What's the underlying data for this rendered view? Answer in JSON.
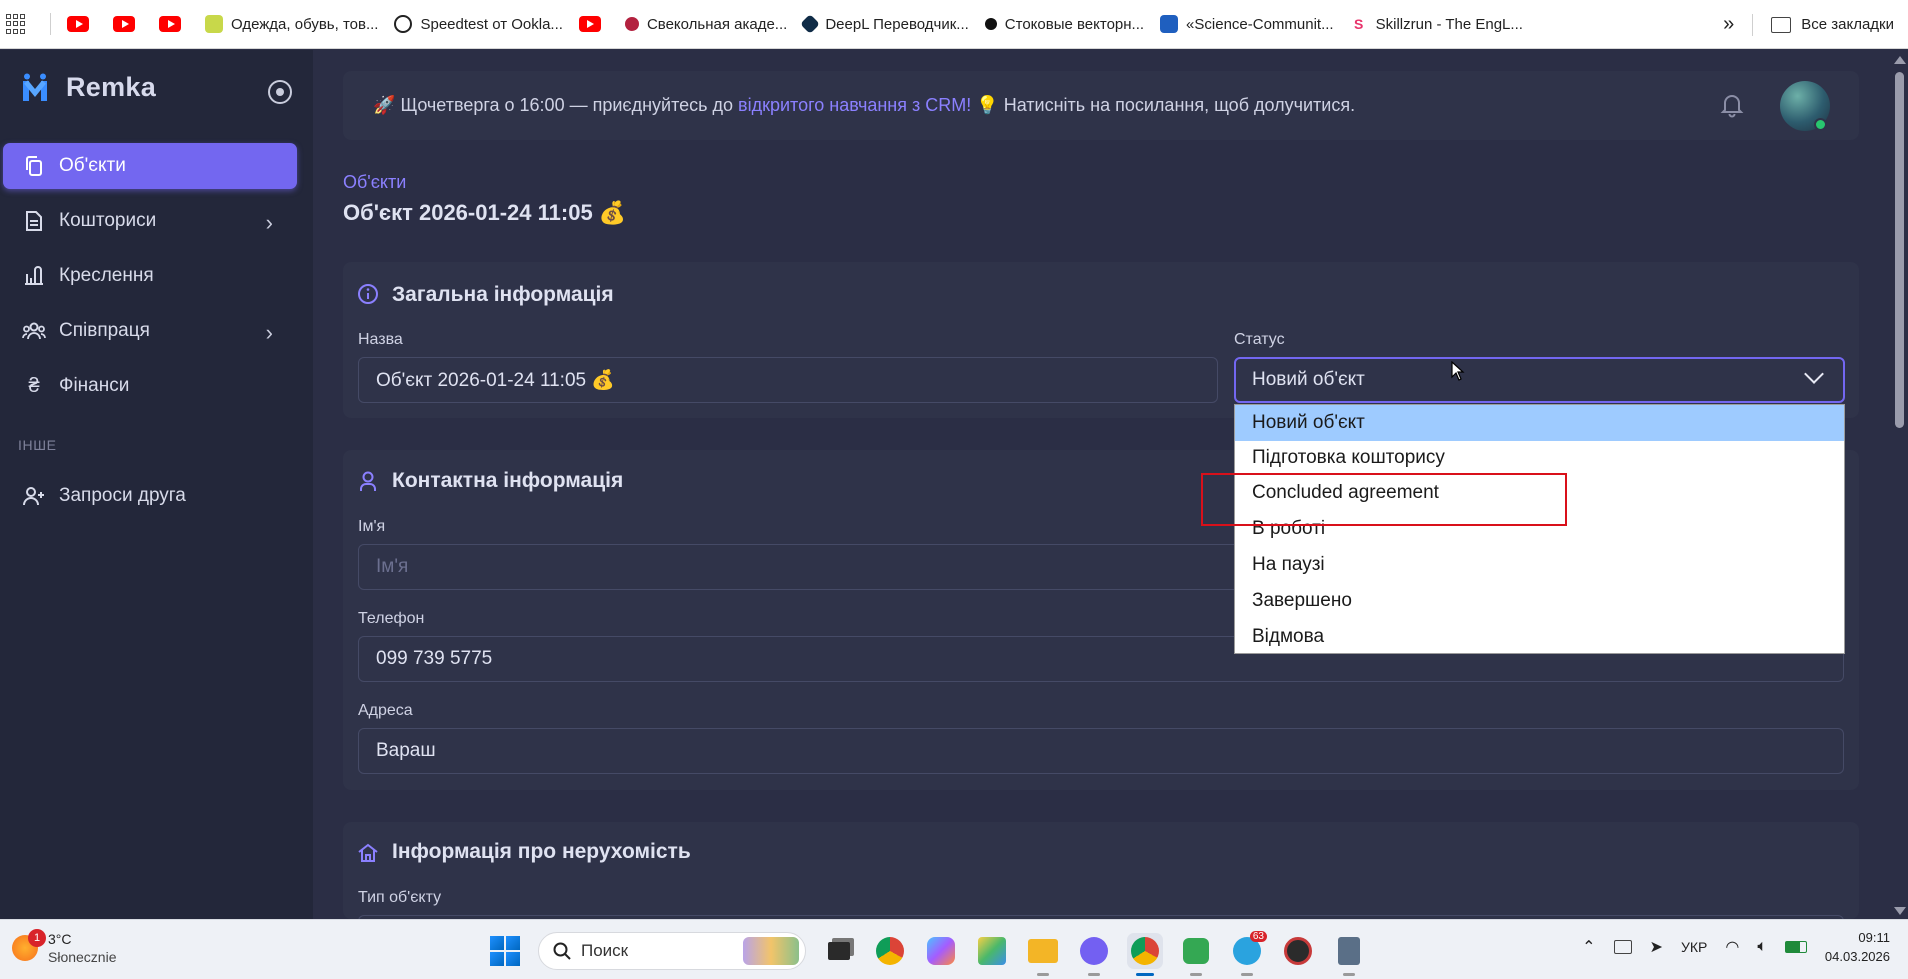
{
  "bookmarks": {
    "items": [
      {
        "label": "",
        "icon": "youtube-icon"
      },
      {
        "label": "",
        "icon": "youtube-icon"
      },
      {
        "label": "",
        "icon": "youtube-icon"
      },
      {
        "label": "Одежда, обувь, тов...",
        "icon": "store-icon"
      },
      {
        "label": "Speedtest от Ookla...",
        "icon": "speedtest-icon"
      },
      {
        "label": "",
        "icon": "youtube-icon"
      },
      {
        "label": "Свекольная акаде...",
        "icon": "beet-icon"
      },
      {
        "label": "DeepL Переводчик...",
        "icon": "deepl-icon"
      },
      {
        "label": "Стоковые векторн...",
        "icon": "stock-icon"
      },
      {
        "label": "«Science-Communit...",
        "icon": "science-icon"
      },
      {
        "label": "Skillzrun - The EngL...",
        "icon": "skillzrun-icon"
      }
    ],
    "overflow": "»",
    "all_bookmarks": "Все закладки"
  },
  "sidebar": {
    "logo": "Remka",
    "items": [
      {
        "label": "Об'єкти",
        "icon": "copy-icon",
        "active": true
      },
      {
        "label": "Кошториси",
        "icon": "document-icon",
        "has_submenu": true
      },
      {
        "label": "Креслення",
        "icon": "ruler-icon"
      },
      {
        "label": "Співпраця",
        "icon": "users-icon",
        "has_submenu": true
      },
      {
        "label": "Фінанси",
        "icon": "currency-icon"
      }
    ],
    "section": "ІНШЕ",
    "other_items": [
      {
        "label": "Запроси друга",
        "icon": "user-plus-icon"
      }
    ]
  },
  "banner": {
    "rocket": "🚀",
    "text_before": "Щочетверга о 16:00 — приєднуйтесь до ",
    "link": "відкритого навчання з CRM!",
    "bulb": "💡",
    "text_after": " Натисніть на посилання, щоб долучитися."
  },
  "breadcrumb": "Об'єкти",
  "page_title": "Об'єкт 2026-01-24 11:05 💰",
  "general_info": {
    "title": "Загальна інформація",
    "name_label": "Назва",
    "name_value": "Об'єкт 2026-01-24 11:05 💰",
    "status_label": "Статус",
    "status_value": "Новий об'єкт",
    "status_options": [
      "Новий об'єкт",
      "Підготовка кошторису",
      "Concluded agreement",
      "В роботі",
      "На паузі",
      "Завершено",
      "Відмова"
    ]
  },
  "contact_info": {
    "title": "Контактна інформація",
    "name_label": "Ім'я",
    "name_placeholder": "Ім'я",
    "phone_label": "Телефон",
    "phone_value": "099 739 5775",
    "address_label": "Адреса",
    "address_value": "Вараш"
  },
  "property_info": {
    "title": "Інформація про нерухомість",
    "type_label": "Тип об'єкту"
  },
  "taskbar": {
    "temperature": "3°C",
    "weather": "Słonecznie",
    "weather_badge": "1",
    "search_placeholder": "Поиск",
    "telegram_badge": "63",
    "language": "УКР",
    "time": "09:11",
    "date": "04.03.2026"
  },
  "colors": {
    "accent": "#7367f0",
    "sidebar_bg": "#23273a",
    "card_bg": "#2f3349",
    "page_bg": "#2b2e45",
    "highlight_red": "#d9101a",
    "selected_option": "#9ecbff"
  }
}
